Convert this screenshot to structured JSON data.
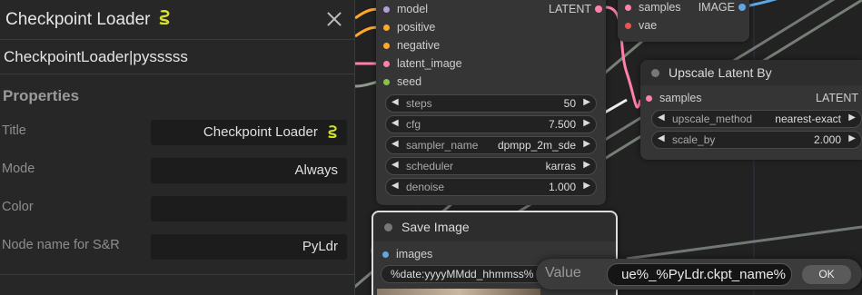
{
  "panel": {
    "title": "Checkpoint Loader",
    "title_icon": "snake-icon",
    "subtitle": "CheckpointLoader|pysssss",
    "properties_heading": "Properties",
    "properties": [
      {
        "label": "Title",
        "value": "Checkpoint Loader"
      },
      {
        "label": "Mode",
        "value": "Always"
      },
      {
        "label": "Color",
        "value": ""
      },
      {
        "label": "Node name for S&R",
        "value": "PyLdr"
      }
    ]
  },
  "ksampler": {
    "inputs": [
      {
        "label": "model",
        "color": "#b39ddb"
      },
      {
        "label": "positive",
        "color": "#ffa726"
      },
      {
        "label": "negative",
        "color": "#ffa726"
      },
      {
        "label": "latent_image",
        "color": "#ff80ab"
      },
      {
        "label": "seed",
        "color": "#8bc34a"
      }
    ],
    "output": "LATENT",
    "widgets": [
      {
        "name": "steps",
        "value": "50"
      },
      {
        "name": "cfg",
        "value": "7.500"
      },
      {
        "name": "sampler_name",
        "value": "dpmpp_2m_sde"
      },
      {
        "name": "scheduler",
        "value": "karras"
      },
      {
        "name": "denoise",
        "value": "1.000"
      }
    ]
  },
  "vae_decode": {
    "inputs": [
      {
        "label": "samples",
        "color": "#ff80ab"
      },
      {
        "label": "vae",
        "color": "#ef5350"
      }
    ],
    "output": "IMAGE"
  },
  "upscale_node": {
    "title": "Upscale Latent By",
    "input": "samples",
    "output": "LATENT",
    "widgets": [
      {
        "name": "upscale_method",
        "value": "nearest-exact"
      },
      {
        "name": "scale_by",
        "value": "2.000"
      }
    ]
  },
  "save_image_node": {
    "title": "Save Image",
    "input": "images",
    "filename_widget": "%date:yyyyMMdd_hhmmss%"
  },
  "value_dialog": {
    "label": "Value",
    "input_value": "ue%_%PyLdr.ckpt_name%",
    "ok_label": "OK"
  }
}
